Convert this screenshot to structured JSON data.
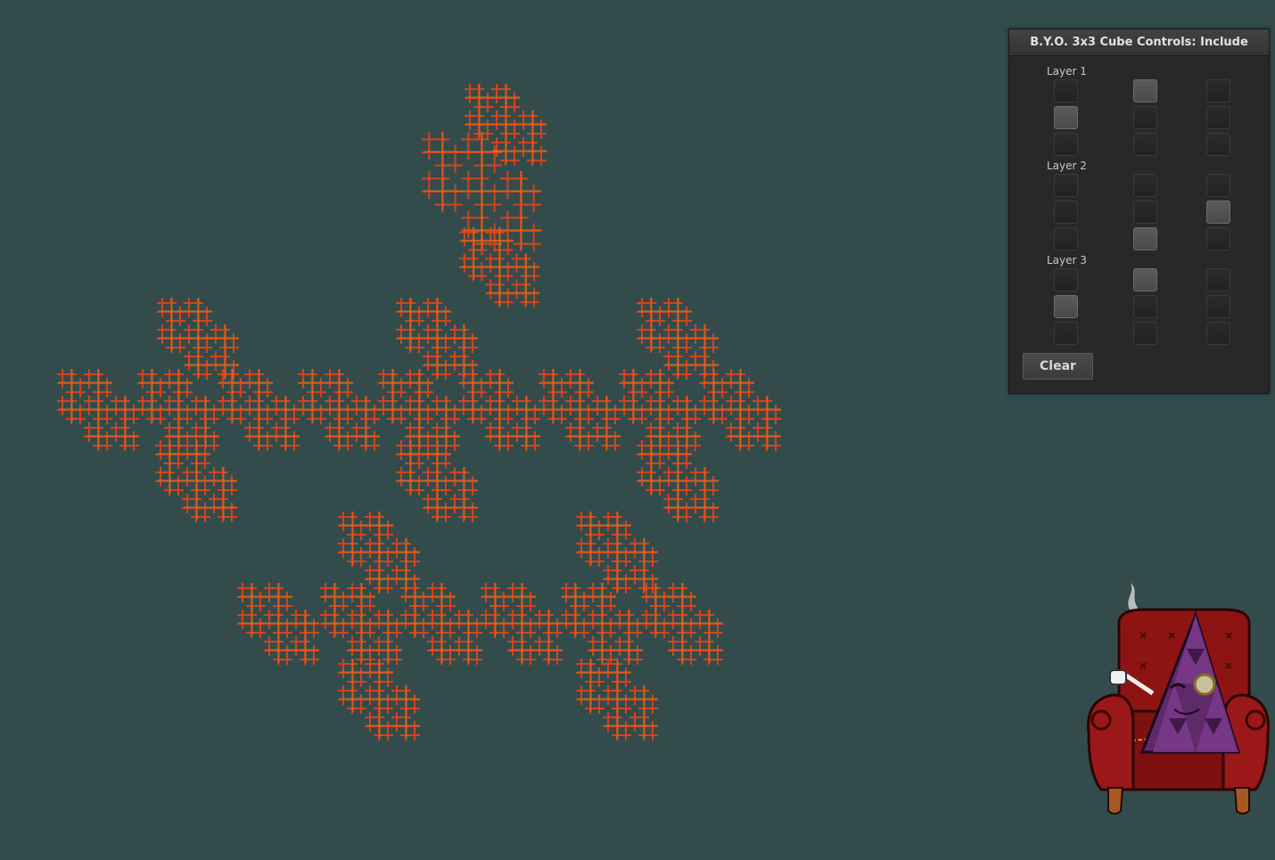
{
  "panel": {
    "title": "B.Y.O. 3x3 Cube Controls: Include",
    "layers": [
      {
        "label": "Layer 1",
        "cells": [
          [
            false,
            true,
            false
          ],
          [
            true,
            false,
            false
          ],
          [
            false,
            false,
            false
          ]
        ]
      },
      {
        "label": "Layer 2",
        "cells": [
          [
            false,
            false,
            false
          ],
          [
            false,
            false,
            true
          ],
          [
            false,
            true,
            false
          ]
        ]
      },
      {
        "label": "Layer 3",
        "cells": [
          [
            false,
            true,
            false
          ],
          [
            true,
            false,
            false
          ],
          [
            false,
            false,
            false
          ]
        ]
      }
    ],
    "clear_label": "Clear"
  },
  "scene": {
    "background": "#344b4b",
    "fractal_color": "#d2441c",
    "fractal_highlight": "#e8a020",
    "mascot": "sierpinski-triangle-character-in-armchair"
  }
}
